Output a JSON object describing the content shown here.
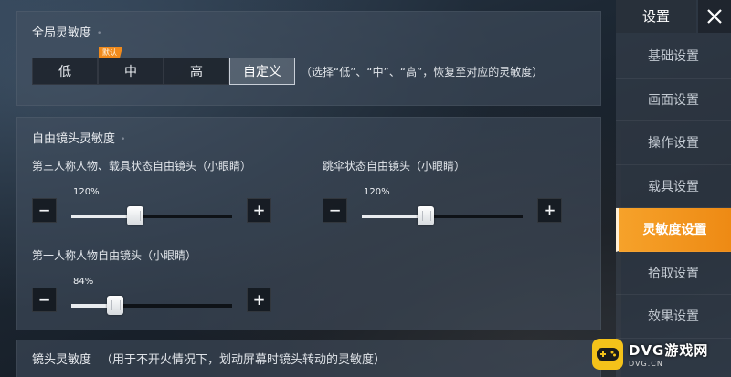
{
  "global_sensitivity": {
    "title": "全局灵敏度",
    "presets": [
      {
        "label": "低",
        "selected": false
      },
      {
        "label": "中",
        "selected": false,
        "tag": "默认"
      },
      {
        "label": "高",
        "selected": false
      },
      {
        "label": "自定义",
        "selected": true
      }
    ],
    "hint": "（选择“低”、“中”、“高”，恢复至对应的灵敏度）"
  },
  "free_camera": {
    "title": "自由镜头灵敏度",
    "sliders": [
      {
        "label": "第三人称人物、载具状态自由镜头（小眼睛）",
        "value_text": "120%",
        "fraction": 0.4
      },
      {
        "label": "跳伞状态自由镜头（小眼睛）",
        "value_text": "120%",
        "fraction": 0.4
      },
      {
        "label": "第一人称人物自由镜头（小眼睛）",
        "value_text": "84%",
        "fraction": 0.27
      }
    ]
  },
  "camera_sensitivity": {
    "title": "镜头灵敏度",
    "subtitle": "（用于不开火情况下，划动屏幕时镜头转动的灵敏度）"
  },
  "sidebar": {
    "title": "设置",
    "items": [
      {
        "label": "基础设置",
        "active": false
      },
      {
        "label": "画面设置",
        "active": false
      },
      {
        "label": "操作设置",
        "active": false
      },
      {
        "label": "载具设置",
        "active": false
      },
      {
        "label": "灵敏度设置",
        "active": true
      },
      {
        "label": "拾取设置",
        "active": false
      },
      {
        "label": "效果设置",
        "active": false
      }
    ]
  },
  "watermark": {
    "main": "DVG游戏网",
    "sub": "DVG.CN"
  },
  "colors": {
    "accent": "#f29318",
    "tag": "#f08a1c"
  }
}
